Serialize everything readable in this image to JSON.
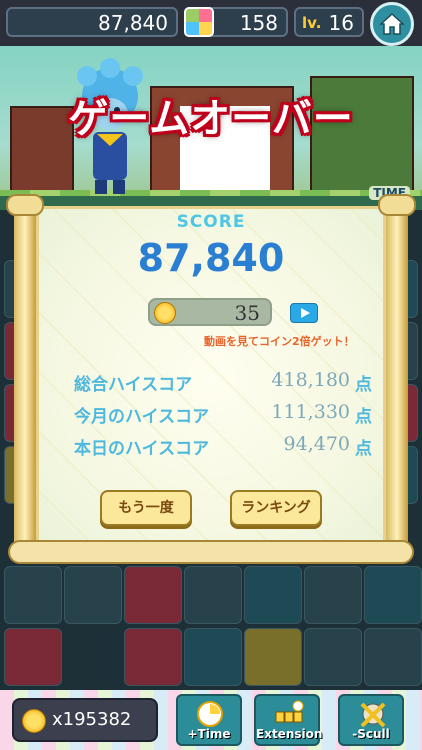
{
  "header": {
    "score": "87,840",
    "gems": "158",
    "level_prefix": "lv.",
    "level": "16",
    "home_icon": "home-icon"
  },
  "scene": {
    "title": "ゲームオーバー",
    "time_label": "TIME"
  },
  "result": {
    "score_label": "SCORE",
    "score_value": "87,840",
    "coins_earned": "35",
    "video_note": "動画を見てコイン2倍ゲット！",
    "high_scores": [
      {
        "label": "総合ハイスコア",
        "value": "418,180",
        "unit": "点"
      },
      {
        "label": "今月のハイスコア",
        "value": "111,330",
        "unit": "点"
      },
      {
        "label": "本日のハイスコア",
        "value": "94,470",
        "unit": "点"
      }
    ],
    "retry_label": "もう一度",
    "ranking_label": "ランキング"
  },
  "footer": {
    "coins_total": "x195382",
    "items": [
      {
        "label": "+Time",
        "icon": "clock-icon"
      },
      {
        "label": "Extension",
        "icon": "extension-icon"
      },
      {
        "label": "-Scull",
        "icon": "skull-icon"
      }
    ]
  },
  "colors": {
    "score_blue": "#2a7fd2",
    "label_cyan": "#4fb8de",
    "gameover_red": "#c0001a",
    "item_teal": "#2c8c97"
  }
}
